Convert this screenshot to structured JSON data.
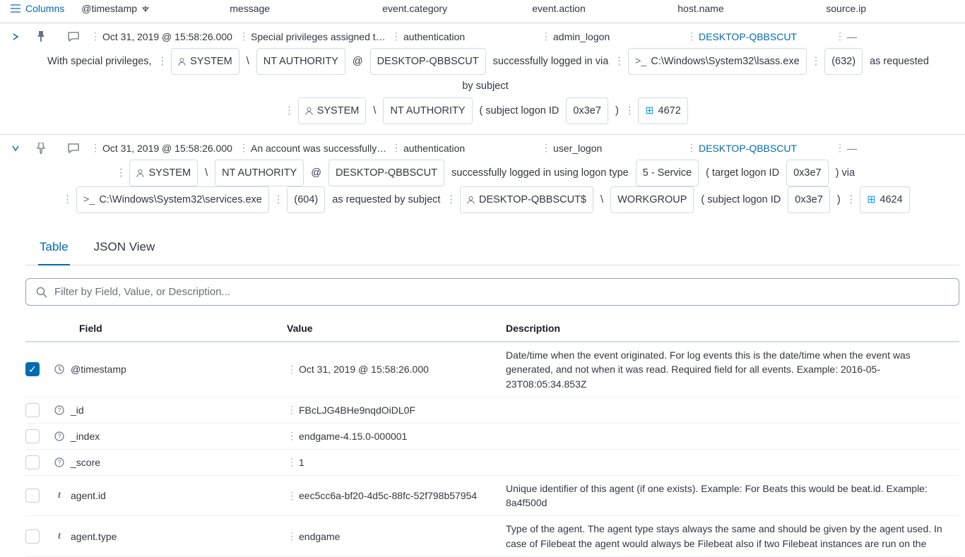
{
  "header": {
    "columns_label": "Columns",
    "cols": {
      "timestamp": "@timestamp",
      "message": "message",
      "category": "event.category",
      "action": "event.action",
      "host": "host.name",
      "source": "source.ip"
    }
  },
  "events": [
    {
      "timestamp": "Oct 31, 2019 @ 15:58:26.000",
      "message": "Special privileges assigned t…",
      "category": "authentication",
      "action": "admin_logon",
      "host": "DESKTOP-QBBSCUT",
      "source": "—",
      "sentence": {
        "pre": "With special privileges,",
        "user": "SYSTEM",
        "slash": "\\",
        "domain": "NT AUTHORITY",
        "at": "@",
        "host": "DESKTOP-QBBSCUT",
        "via_text": "successfully logged in via",
        "process": "C:\\Windows\\System32\\lsass.exe",
        "pid": "(632)",
        "req_by": "as requested by subject",
        "subj_user": "SYSTEM",
        "slash2": "\\",
        "subj_domain": "NT AUTHORITY",
        "logonid_label": "( subject logon ID",
        "logonid": "0x3e7",
        "close": ")",
        "code": "4672"
      }
    },
    {
      "timestamp": "Oct 31, 2019 @ 15:58:26.000",
      "message": "An account was successfully…",
      "category": "authentication",
      "action": "user_logon",
      "host": "DESKTOP-QBBSCUT",
      "source": "—",
      "sentence": {
        "user": "SYSTEM",
        "slash": "\\",
        "domain": "NT AUTHORITY",
        "at": "@",
        "host": "DESKTOP-QBBSCUT",
        "logged_text": "successfully logged in using logon type",
        "logon_type": "5 - Service",
        "target_label": "( target logon ID",
        "target_id": "0x3e7",
        "via": ") via",
        "process": "C:\\Windows\\System32\\services.exe",
        "pid": "(604)",
        "req_by": "as requested by subject",
        "subj_user": "DESKTOP-QBBSCUT$",
        "slash2": "\\",
        "subj_domain": "WORKGROUP",
        "subj_label": "( subject logon ID",
        "subj_id": "0x3e7",
        "close": ")",
        "code": "4624"
      }
    }
  ],
  "tabs": {
    "table": "Table",
    "json": "JSON View"
  },
  "filter_placeholder": "Filter by Field, Value, or Description...",
  "table_head": {
    "field": "Field",
    "value": "Value",
    "desc": "Description"
  },
  "rows": [
    {
      "checked": true,
      "icon": "clock",
      "name": "@timestamp",
      "value": "Oct 31, 2019 @ 15:58:26.000",
      "desc": "Date/time when the event originated. For log events this is the date/time when the event was generated, and not when it was read. Required field for all events. Example: 2016-05-23T08:05:34.853Z"
    },
    {
      "checked": false,
      "icon": "q",
      "name": "_id",
      "value": "FBcLJG4BHe9nqdOiDL0F",
      "desc": ""
    },
    {
      "checked": false,
      "icon": "q",
      "name": "_index",
      "value": "endgame-4.15.0-000001",
      "desc": ""
    },
    {
      "checked": false,
      "icon": "q",
      "name": "_score",
      "value": "1",
      "desc": ""
    },
    {
      "checked": false,
      "icon": "t",
      "name": "agent.id",
      "value": "eec5cc6a-bf20-4d5c-88fc-52f798b57954",
      "desc": "Unique identifier of this agent (if one exists). Example: For Beats this would be beat.id. Example: 8a4f500d"
    },
    {
      "checked": false,
      "icon": "t",
      "name": "agent.type",
      "value": "endgame",
      "desc": "Type of the agent. The agent type stays always the same and should be given by the agent used. In case of Filebeat the agent would always be Filebeat also if two Filebeat instances are run on the"
    }
  ]
}
